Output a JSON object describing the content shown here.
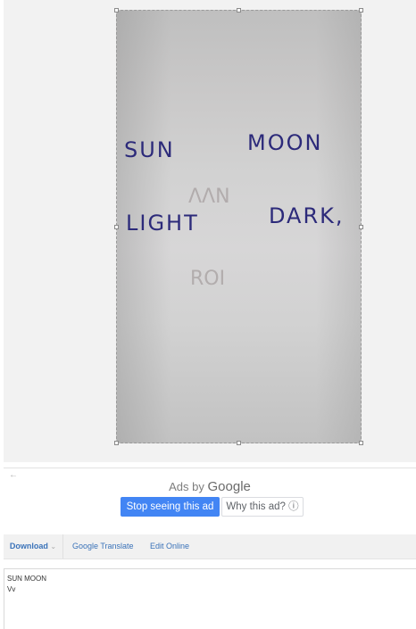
{
  "preview": {
    "handwriting": {
      "word_1": "SUN",
      "word_2": "MOON",
      "word_3": "LIGHT",
      "word_4": "DARK,",
      "ghost_1": "ɅɅN",
      "ghost_2": "ROI"
    }
  },
  "ad": {
    "back_arrow": "←",
    "ads_by_prefix": "Ads by",
    "ads_by_brand": "Google",
    "stop_label": "Stop seeing this ad",
    "why_label": "Why this ad? ⓘ"
  },
  "toolbar": {
    "download_label": "Download",
    "download_caret": "⌄",
    "translate_label": "Google Translate",
    "edit_label": "Edit Online"
  },
  "result": {
    "text": "SUN MOON\nVv"
  },
  "colors": {
    "accent": "#4285f4",
    "link": "#3b73b9",
    "ink": "#2c2a7a"
  }
}
